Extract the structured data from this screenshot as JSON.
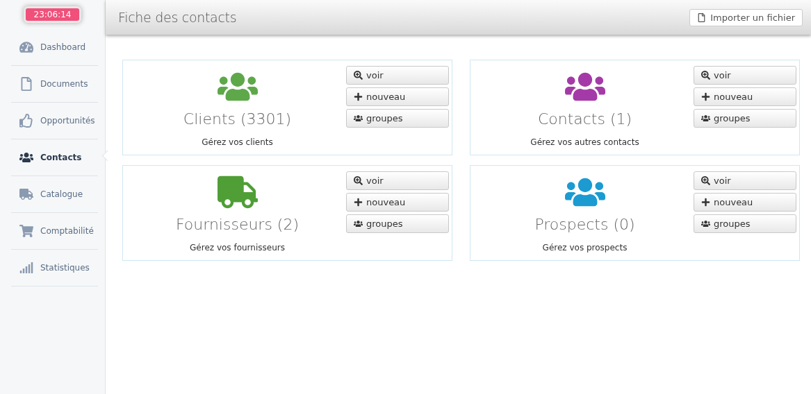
{
  "clock": "23:06:14",
  "sidebar": {
    "items": [
      {
        "label": "Dashboard",
        "selected": false
      },
      {
        "label": "Documents",
        "selected": false
      },
      {
        "label": "Opportunités",
        "selected": false
      },
      {
        "label": "Contacts",
        "selected": true
      },
      {
        "label": "Catalogue",
        "selected": false
      },
      {
        "label": "Comptabilité",
        "selected": false
      },
      {
        "label": "Statistiques",
        "selected": false
      }
    ]
  },
  "header": {
    "title": "Fiche des contacts",
    "import_button": "Importer un fichier"
  },
  "cards": [
    {
      "title": "Clients (3301)",
      "description": "Gérez vos clients",
      "color": "#5ea84a",
      "buttons": [
        "voir",
        "nouveau",
        "groupes"
      ]
    },
    {
      "title": "Contacts (1)",
      "description": "Gérez vos autres contacts",
      "color": "#a43aa8",
      "buttons": [
        "voir",
        "nouveau",
        "groupes"
      ]
    },
    {
      "title": "Fournisseurs (2)",
      "description": "Gérez vos fournisseurs",
      "color": "#4f9e36",
      "buttons": [
        "voir",
        "nouveau",
        "groupes"
      ]
    },
    {
      "title": "Prospects (0)",
      "description": "Gérez vos prospects",
      "color": "#1b9bd1",
      "buttons": [
        "voir",
        "nouveau",
        "groupes"
      ]
    }
  ]
}
